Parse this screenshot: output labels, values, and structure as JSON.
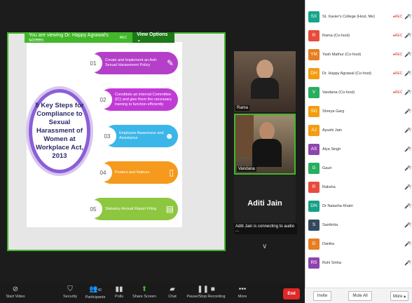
{
  "banner": {
    "viewing": "You are viewing  Dr. Happy Agrawal's screen",
    "rec": "REC",
    "view_options": "View Options ⌄"
  },
  "slide": {
    "center": "5 Key Steps for Compliance to Sexual Harassment of Women at Workplace Act, 2013",
    "steps": [
      {
        "step": "STEP",
        "num": "01",
        "text": "Create and Implement an Anti-Sexual Harassment Policy",
        "color": "#b43fc9"
      },
      {
        "step": "STEP",
        "num": "02",
        "text": "Constitute an internal Committee (IC) and give them the necessary training to function efficiently",
        "color": "#c23ad6"
      },
      {
        "step": "STEP",
        "num": "03",
        "text": "Employee Awareness and Assistance",
        "color": "#3cb6e8"
      },
      {
        "step": "STEP",
        "num": "04",
        "text": "Posters and Notices",
        "color": "#f59a1c"
      },
      {
        "step": "STEP",
        "num": "05",
        "text": "Statutory Annual Report Filing",
        "color": "#8dc63f"
      }
    ]
  },
  "videos": [
    {
      "name": "Rama"
    },
    {
      "name": "Vandana"
    }
  ],
  "aditi": {
    "name": "Aditi Jain",
    "status": "Aditi Jain is connecting to audio ..."
  },
  "toolbar": {
    "start_video": "Start Video",
    "security": "Security",
    "participants": "Participants",
    "participants_count": "42",
    "polls": "Polls",
    "share": "Share Screen",
    "chat": "Chat",
    "record": "Pause/Stop Recording",
    "more": "More",
    "end": "End"
  },
  "participants": [
    {
      "init": "SX",
      "name": "St. Xavier's College (Host, Me)",
      "rec": "●REC",
      "color": "#17a589"
    },
    {
      "init": "R",
      "name": "Rama (Co-host)",
      "rec": "●REC",
      "color": "#e74c3c"
    },
    {
      "init": "YM",
      "name": "Yash Mathur (Co-host)",
      "rec": "●REC",
      "color": "#e67e22"
    },
    {
      "init": "DH",
      "name": "Dr. Happy Agrawal (Co-host)",
      "rec": "●REC",
      "color": "#f39c12"
    },
    {
      "init": "V",
      "name": "Vandana (Co-host)",
      "rec": "●REC",
      "color": "#27ae60"
    },
    {
      "init": "SG",
      "name": "Shreya Garg",
      "rec": "",
      "color": "#f39c12"
    },
    {
      "init": "AJ",
      "name": "Ayushi Jain",
      "rec": "",
      "color": "#f39c12"
    },
    {
      "init": "AS",
      "name": "Alya Singh",
      "rec": "",
      "color": "#8e44ad"
    },
    {
      "init": "G",
      "name": "Gauri",
      "rec": "",
      "color": "#27ae60"
    },
    {
      "init": "R",
      "name": "Raksha",
      "rec": "",
      "color": "#e74c3c"
    },
    {
      "init": "DN",
      "name": "Dr Natasha Khatri",
      "rec": "",
      "color": "#16a085"
    },
    {
      "init": "S",
      "name": "Sambrita",
      "rec": "",
      "color": "#34495e"
    },
    {
      "init": "D",
      "name": "Danika",
      "rec": "",
      "color": "#e67e22"
    },
    {
      "init": "RS",
      "name": "Ruhi Sinha",
      "rec": "",
      "color": "#8e44ad"
    }
  ],
  "panel_footer": {
    "invite": "Invite",
    "mute_all": "Mute All",
    "more": "More ▴"
  }
}
